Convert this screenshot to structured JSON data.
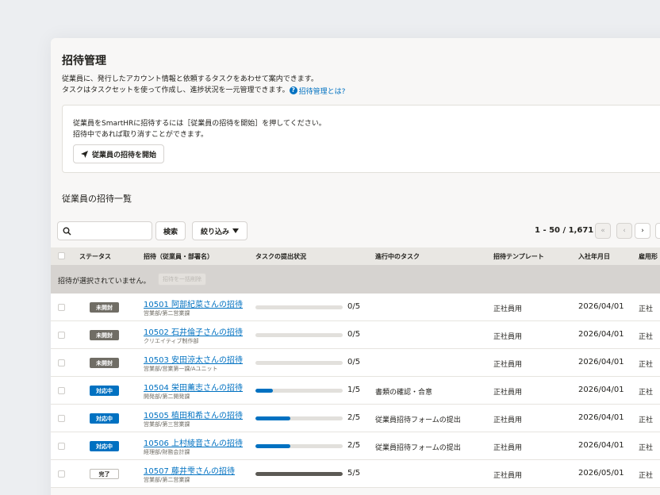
{
  "page": {
    "title": "招待管理",
    "desc_line1": "従業員に、発行したアカウント情報と依頼するタスクをあわせて案内できます。",
    "desc_line2": "タスクはタスクセットを使って作成し、進捗状況を一元管理できます。",
    "help_link": "招待管理とは?",
    "help_icon": "question-icon"
  },
  "info_box": {
    "line1": "従業員をSmartHRに招待するには［従業員の招待を開始］を押してください。",
    "line2": "招待中であれば取り消すことができます。",
    "start_button": "従業員の招待を開始",
    "start_icon": "paper-plane-icon"
  },
  "list": {
    "title": "従業員の招待一覧",
    "search_placeholder": "",
    "search_button": "検索",
    "filter_button": "絞り込み",
    "pagination": "1 - 50 / 1,671",
    "pager_first": "«",
    "pager_prev": "‹",
    "pager_next": "›",
    "pager_last": "»"
  },
  "table": {
    "headers": {
      "status": "ステータス",
      "invitation": "招待（従業員・部署名）",
      "progress": "タスクの提出状況",
      "current_task": "進行中のタスク",
      "template": "招待テンプレート",
      "join_date": "入社年月日",
      "employment": "雇用形"
    },
    "bulk_text": "招待が選択されていません。",
    "bulk_button": "招待を一括削除",
    "rows": [
      {
        "status": "未開封",
        "status_type": "unopened",
        "name": "10501 阿部紀菜さんの招待",
        "dept": "営業部/第二営業課",
        "progress": "0/5",
        "progress_fraction": 0,
        "task": "",
        "template": "正社員用",
        "date": "2026/04/01",
        "employment": "正社"
      },
      {
        "status": "未開封",
        "status_type": "unopened",
        "name": "10502 石井倫子さんの招待",
        "dept": "クリエイティブ制作部",
        "progress": "0/5",
        "progress_fraction": 0,
        "task": "",
        "template": "正社員用",
        "date": "2026/04/01",
        "employment": "正社"
      },
      {
        "status": "未開封",
        "status_type": "unopened",
        "name": "10503 安田涼太さんの招待",
        "dept": "営業部/営業第一課/Aユニット",
        "progress": "0/5",
        "progress_fraction": 0,
        "task": "",
        "template": "正社員用",
        "date": "2026/04/01",
        "employment": "正社"
      },
      {
        "status": "対応中",
        "status_type": "active",
        "name": "10504 栄田薫志さんの招待",
        "dept": "開発部/第二開発課",
        "progress": "1/5",
        "progress_fraction": 0.2,
        "task": "書類の確認・合意",
        "template": "正社員用",
        "date": "2026/04/01",
        "employment": "正社"
      },
      {
        "status": "対応中",
        "status_type": "active",
        "name": "10505 植田和希さんの招待",
        "dept": "営業部/第三営業課",
        "progress": "2/5",
        "progress_fraction": 0.4,
        "task": "従業員招待フォームの提出",
        "template": "正社員用",
        "date": "2026/04/01",
        "employment": "正社"
      },
      {
        "status": "対応中",
        "status_type": "active",
        "name": "10506 上村綾音さんの招待",
        "dept": "経理部/財務会計課",
        "progress": "2/5",
        "progress_fraction": 0.4,
        "task": "従業員招待フォームの提出",
        "template": "正社員用",
        "date": "2026/04/01",
        "employment": "正社"
      },
      {
        "status": "完了",
        "status_type": "done",
        "name": "10507 藤井雫さんの招待",
        "dept": "営業部/第二営業課",
        "progress": "5/5",
        "progress_fraction": 1,
        "task": "",
        "template": "正社員用",
        "date": "2026/05/01",
        "employment": "正社"
      }
    ]
  },
  "colors": {
    "accent": "#0071c1",
    "unopened": "#706d65",
    "done_bar": "#5c5a55"
  }
}
